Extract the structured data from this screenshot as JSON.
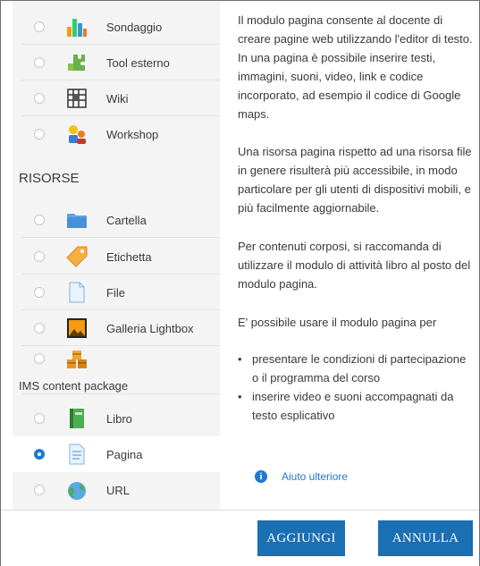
{
  "activities": [
    {
      "label": "Sondaggio",
      "icon": "bar-chart-icon"
    },
    {
      "label": "Tool esterno",
      "icon": "puzzle-icon"
    },
    {
      "label": "Wiki",
      "icon": "wiki-icon"
    },
    {
      "label": "Workshop",
      "icon": "workshop-icon"
    }
  ],
  "resources_heading": "RISORSE",
  "resources": [
    {
      "label": "Cartella",
      "icon": "folder-icon"
    },
    {
      "label": "Etichetta",
      "icon": "tag-icon"
    },
    {
      "label": "File",
      "icon": "file-icon"
    },
    {
      "label": "Galleria Lightbox",
      "icon": "image-gallery-icon"
    },
    {
      "label": "IMS content package",
      "icon": "package-boxes-icon"
    },
    {
      "label": "Libro",
      "icon": "book-icon"
    },
    {
      "label": "Pagina",
      "icon": "page-icon",
      "selected": true
    },
    {
      "label": "URL",
      "icon": "globe-icon"
    }
  ],
  "description": {
    "p1": "Il modulo pagina consente al docente di creare pagine web utilizzando l'editor di testo. In una pagina è possibile inserire testi, immagini, suoni, video, link e codice incorporato, ad esempio il codice di Google maps.",
    "p2": "Una risorsa pagina rispetto ad una risorsa file in genere risulterà più accessibile, in modo particolare per gli utenti di dispositivi mobili, e più facilmente aggiornabile.",
    "p3": "Per contenuti corposi, si raccomanda di utilizzare il modulo di attività libro al posto del modulo pagina.",
    "p4": "E' possibile usare il modulo pagina per",
    "bullets": [
      "presentare le condizioni di partecipazione o il programma del corso",
      "inserire video e suoni accompagnati da testo esplicativo"
    ]
  },
  "help_link": "Aiuto ulteriore",
  "buttons": {
    "add": "AGGIUNGI",
    "cancel": "ANNULLA"
  },
  "colors": {
    "accent": "#1f78d1",
    "button": "#1b6fb3"
  }
}
